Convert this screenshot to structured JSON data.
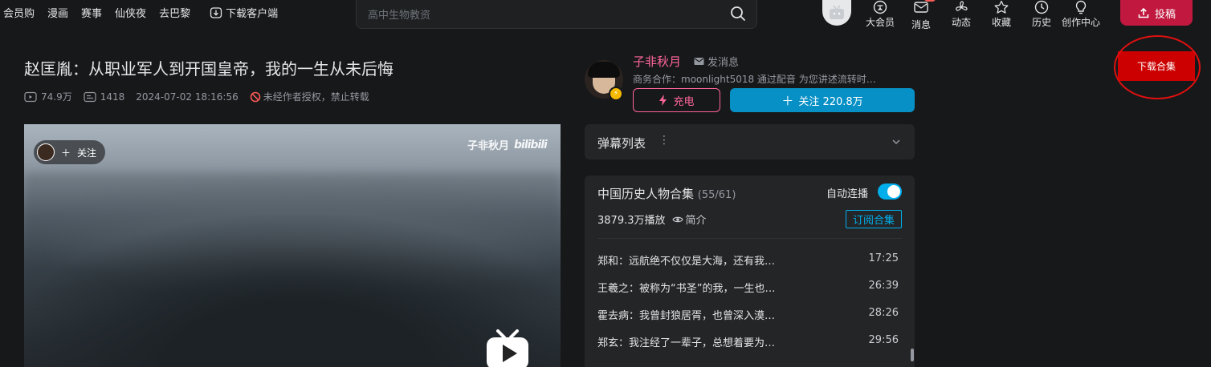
{
  "topnav": {
    "items": [
      "会员购",
      "漫画",
      "赛事",
      "仙侠夜",
      "去巴黎"
    ],
    "download_client": "下载客户端"
  },
  "search": {
    "placeholder": "高中生物教资"
  },
  "right_nav": {
    "vip": "大会员",
    "messages": "消息",
    "dynamics": "动态",
    "favorites": "收藏",
    "history": "历史",
    "creator": "创作中心",
    "upload": "投稿"
  },
  "video": {
    "title": "赵匡胤：从职业军人到开国皇帝，我的一生从未后悔",
    "views": "74.9万",
    "danmaku_count": "1418",
    "publish_time": "2024-07-02 18:16:56",
    "copyright": "未经作者授权，禁止转载"
  },
  "player": {
    "follow_label": "关注",
    "watermark_name": "子非秋月",
    "watermark_logo": "bilibili"
  },
  "uploader": {
    "name": "子非秋月",
    "send_message": "发消息",
    "description": "商务合作：moonlight5018 通过配音 为您讲述流转时…",
    "charge": "充电",
    "follow": "关注 220.8万"
  },
  "danmaku_list": {
    "title": "弹幕列表"
  },
  "collection": {
    "title": "中国历史人物合集",
    "progress": "(55/61)",
    "autoplay_label": "自动连播",
    "autoplay_on": true,
    "plays": "3879.3万播放",
    "intro": "简介",
    "subscribe": "订阅合集",
    "episodes": [
      {
        "name": "郑和：远航绝不仅仅是大海，还有我…",
        "duration": "17:25"
      },
      {
        "name": "王羲之：被称为“书圣”的我，一生也…",
        "duration": "26:39"
      },
      {
        "name": "霍去病：我曾封狼居胥，也曾深入漠…",
        "duration": "28:26"
      },
      {
        "name": "郑玄：我注经了一辈子，总想着要为…",
        "duration": "29:56"
      }
    ]
  },
  "download_collection": "下载合集",
  "colors": {
    "background": "#17181a",
    "panel": "#232527",
    "brand_pink": "#ff6699",
    "brand_blue": "#00aeec",
    "follow_blue": "#0790c6",
    "upload_red": "#c0183e",
    "download_red": "#cc0000"
  }
}
